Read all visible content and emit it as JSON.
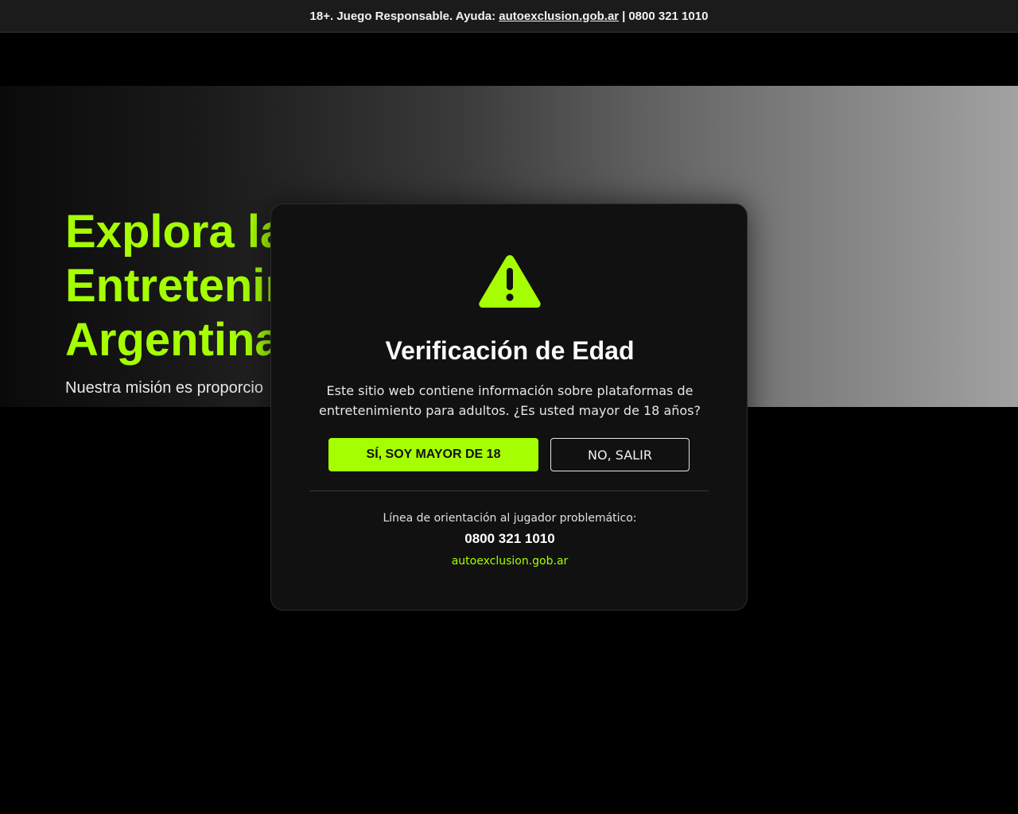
{
  "colors": {
    "accent": "#a6ff00",
    "modal_bg": "#111111",
    "topbar_bg": "#1b1b1b"
  },
  "topbar": {
    "text": "18+. Juego Responsable. Ayuda:",
    "link": "autoexclusion.gob.ar",
    "separator": "|",
    "phone": "0800 321 1010"
  },
  "hero": {
    "title_lines": [
      "Explora la",
      "Entretenim",
      "Argentina"
    ],
    "subtitle": "Nuestra misión es proporcio"
  },
  "modal": {
    "icon": "warning-triangle-icon",
    "title": "Verificación de Edad",
    "text": "Este sitio web contiene información sobre plataformas de entretenimiento para adultos. ¿Es usted mayor de 18 años?",
    "yes_label": "SÍ, SOY MAYOR DE 18",
    "no_label": "NO, SALIR",
    "help_label": "Línea de orientación al jugador problemático:",
    "help_phone": "0800 321 1010",
    "help_link": "autoexclusion.gob.ar"
  }
}
